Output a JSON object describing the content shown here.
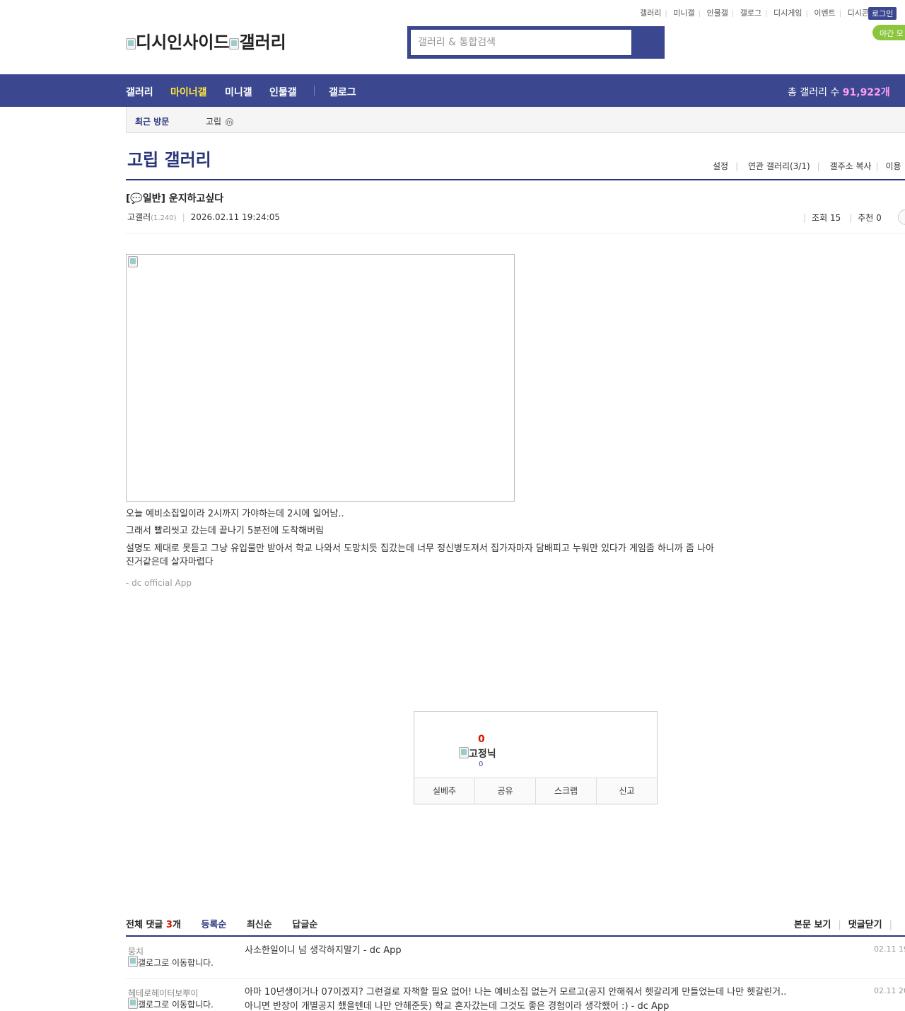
{
  "util_nav": [
    "갤러리",
    "미니갤",
    "인물갤",
    "갤로그",
    "디시게임",
    "이벤트",
    "디시콘"
  ],
  "login_label": "로그인",
  "night_label": "야간 모",
  "logo": {
    "site": "디시인사이드",
    "gallery": "갤러리"
  },
  "search": {
    "placeholder": "갤러리 & 통합검색"
  },
  "gnb": {
    "menu": [
      "갤러리",
      "마이너갤",
      "미니갤",
      "인물갤",
      "갤로그"
    ],
    "total_label": "총 갤러리 수",
    "total_value": "91,922개"
  },
  "recent": {
    "label": "최근 방문",
    "item": "고립",
    "badge": "m"
  },
  "gallery": {
    "title": "고립 갤러리",
    "tools": [
      "설정",
      "연관 갤러리(3/1)",
      "갤주소 복사",
      "이용"
    ]
  },
  "post": {
    "title": "[💬일반] 운지하고싶다",
    "author": "고갤러",
    "ip": "(1.240)",
    "date": "2026.02.11 19:24:05",
    "views_label": "조회 15",
    "recommend_label": "추천 0",
    "lines": [
      "오늘 예비소집일이라 2시까지 가야하는데 2시에 일어남..",
      "그래서 빨리씻고 갔는데 끝나기 5분전에 도착해버림",
      "설명도 제대로 못듣고 그냥 유입물만 받아서 학교 나와서 도망치듯 집갔는데 너무 정신병도져서 집가자마자 담배피고 누워만 있다가 게임좀 하니까 좀 나아",
      "진거같은데 살자마렵다"
    ],
    "signature": "- dc official App"
  },
  "recommend_box": {
    "count": "0",
    "name": "고정닉",
    "sub_count": "0",
    "actions": [
      "실베추",
      "공유",
      "스크랩",
      "신고"
    ]
  },
  "comments": {
    "total_label": "전체 댓글",
    "total_count": "3",
    "total_unit": "개",
    "sorts": [
      "등록순",
      "최신순",
      "답글순"
    ],
    "right_tools": [
      "본문 보기",
      "댓글닫기"
    ],
    "items": [
      {
        "nick": "뭉치",
        "gallog": "갤로그로 이동합니다.",
        "lines": [
          "사소한일이니 넘 생각하지말기 - dc App"
        ],
        "date": "02.11 19"
      },
      {
        "nick": "헤테로헤이터보뿌이",
        "gallog": "갤로그로 이동합니다.",
        "lines": [
          "아마 10년생이거나 07이겠지? 그런걸로 자책할 필요 없어! 나는 예비소집 없는거 모르고(공지 안해줘서 헷갈리게 만들었는데 나만 헷갈린거..",
          "아니면 반장이 개별공지 했을텐데 나만 안해준듯) 학교 혼자갔는데 그것도 좋은 경험이라 생각했어 :) - dc App"
        ],
        "date": "02.11 20"
      }
    ]
  },
  "colors": {
    "brand": "#3b4890",
    "accent": "#ffe63c",
    "count_red": "#d31900"
  }
}
